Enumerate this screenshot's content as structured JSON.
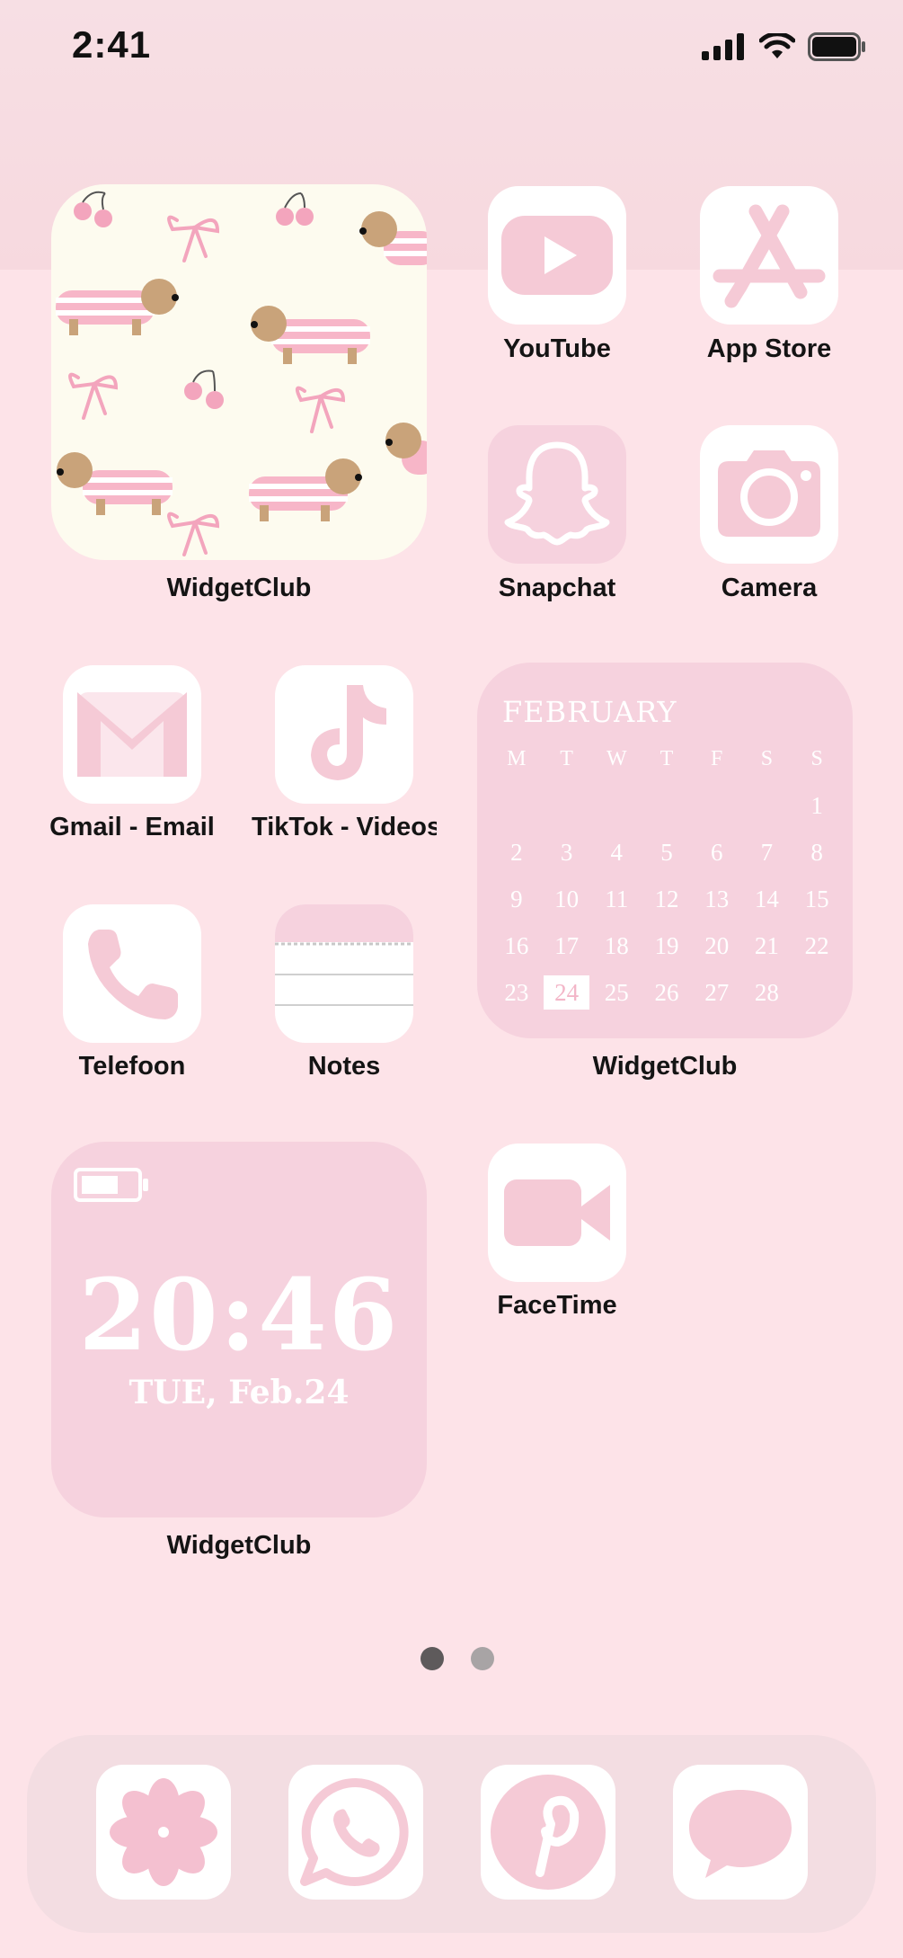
{
  "status_bar": {
    "time": "2:41",
    "icons": [
      "signal-icon",
      "wifi-icon",
      "battery-icon"
    ]
  },
  "colors": {
    "accent_pink": "#f6d2de",
    "icon_pink": "#f5cad6",
    "background": "#fde3e8"
  },
  "apps": {
    "youtube": "YouTube",
    "app_store": "App Store",
    "snapchat": "Snapchat",
    "camera": "Camera",
    "gmail": "Gmail - Email",
    "tiktok": "TikTok - Videos",
    "telefoon": "Telefoon",
    "notes": "Notes",
    "facetime": "FaceTime"
  },
  "widgets": {
    "photo": {
      "label": "WidgetClub"
    },
    "calendar": {
      "label": "WidgetClub",
      "month": "FEBRUARY",
      "weekdays": [
        "M",
        "T",
        "W",
        "T",
        "F",
        "S",
        "S"
      ],
      "days": [
        "",
        "",
        "",
        "",
        "",
        "",
        "1",
        "2",
        "3",
        "4",
        "5",
        "6",
        "7",
        "8",
        "9",
        "10",
        "11",
        "12",
        "13",
        "14",
        "15",
        "16",
        "17",
        "18",
        "19",
        "20",
        "21",
        "22",
        "23",
        "24",
        "25",
        "26",
        "27",
        "28",
        ""
      ],
      "today": "24"
    },
    "clock": {
      "label": "WidgetClub",
      "time": "20:46",
      "date": "TUE, Feb.24"
    }
  },
  "page_indicator": {
    "count": 2,
    "current": 1
  },
  "dock": [
    "photos-icon",
    "whatsapp-icon",
    "pinterest-icon",
    "messages-icon"
  ]
}
